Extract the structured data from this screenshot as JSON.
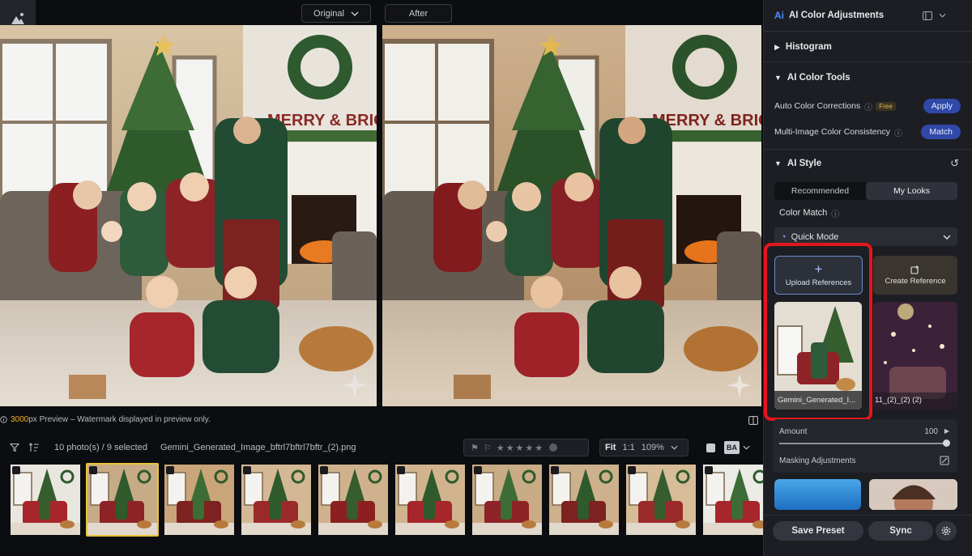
{
  "compare": {
    "original_label": "Original",
    "after_label": "After"
  },
  "scene": {
    "banner_text": "MERRY & BRIGHT"
  },
  "preview": {
    "size": "3000",
    "suffix": "px Preview – Watermark displayed in preview only."
  },
  "filmstrip": {
    "count": "10 photo(s) / 9 selected",
    "filename": "Gemini_Generated_Image_bftrl7bftrl7bftr_(2).png",
    "fit_label": "Fit",
    "one_to_one": "1:1",
    "zoom": "109%",
    "ba_label": "BA",
    "thumb_count": 10,
    "selected_index": 1
  },
  "panel": {
    "header_title": "AI Color Adjustments",
    "histogram_title": "Histogram",
    "tools_title": "AI Color Tools",
    "auto_label": "Auto Color Corrections",
    "free_badge": "Free",
    "apply_label": "Apply",
    "multi_label": "Multi-Image Color Consistency",
    "match_label": "Match",
    "style_title": "AI Style",
    "tab_recommended": "Recommended",
    "tab_mylooks": "My Looks",
    "color_match_label": "Color Match",
    "mode_label": "Quick Mode",
    "upload_label": "Upload References",
    "create_label": "Create Reference",
    "ref1_name": "Gemini_Generated_I...",
    "ref2_name": "11_(2)_(2) (2)",
    "amount_label": "Amount",
    "amount_value": "100",
    "amount_fraction": 1.0,
    "masking_label": "Masking Adjustments",
    "save_preset": "Save Preset",
    "sync": "Sync"
  },
  "colors": {
    "accent_blue": "#3048a8",
    "highlight_red": "#e4161d",
    "selected_thumb": "#e8c53a"
  }
}
